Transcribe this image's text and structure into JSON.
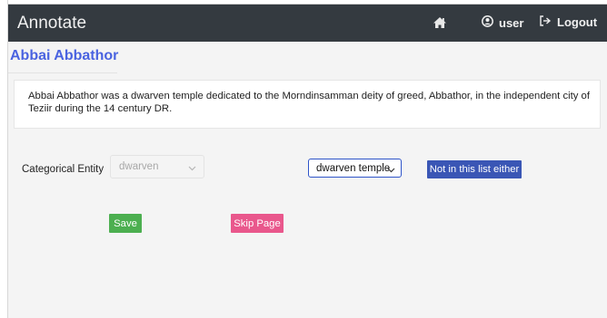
{
  "navbar": {
    "brand": "Annotate",
    "home_icon": "home-icon",
    "user_icon": "user-circle-icon",
    "user_label": "user",
    "logout_icon": "sign-out-icon",
    "logout_label": "Logout"
  },
  "page": {
    "title": "Abbai Abbathor",
    "description": "Abbai Abbathor was a dwarven temple dedicated to the Morndinsamman deity of greed, Abbathor, in the independent city of Teziir during the 14 century DR."
  },
  "form": {
    "entity_label": "Categorical Entity",
    "disabled_select_value": "dwarven",
    "active_select_value": "dwarven temple",
    "not_in_list_label": "Not in this list either",
    "save_label": "Save",
    "skip_label": "Skip Page"
  },
  "colors": {
    "navbar_bg": "#343a40",
    "title_color": "#4a63e0",
    "save_bg": "#4caf50",
    "skip_bg": "#e9578c",
    "not_in_list_bg": "#3a56b5"
  }
}
